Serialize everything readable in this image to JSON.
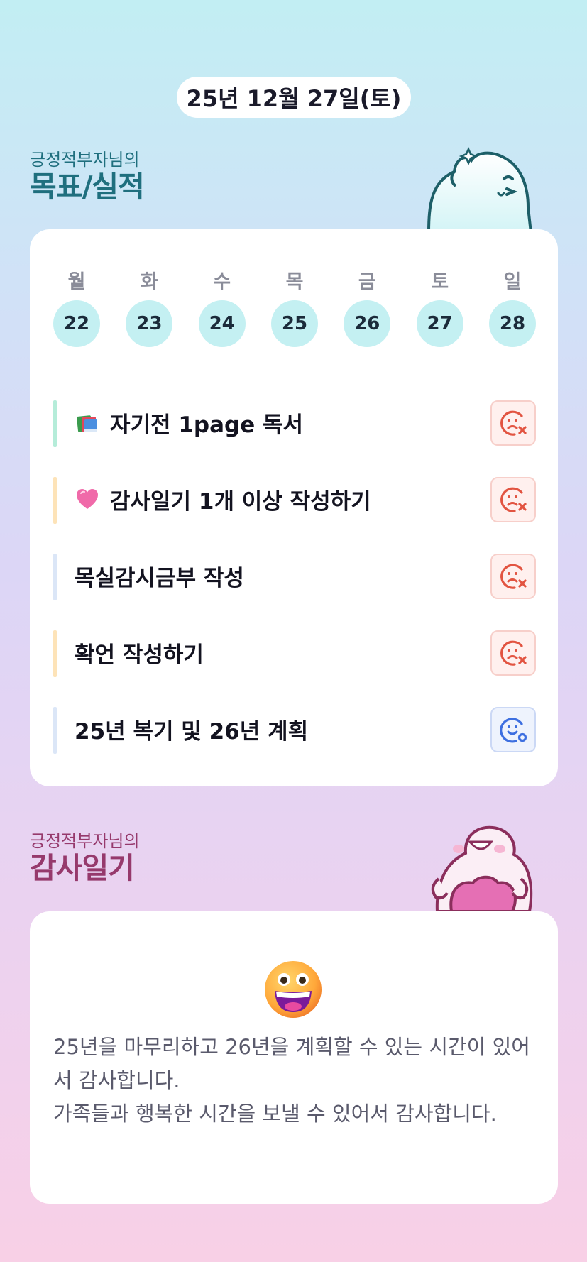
{
  "date": "25년 12월 27일(토)",
  "goals_section": {
    "subtitle": "긍정적부자님의",
    "title": "목표/실적"
  },
  "week": {
    "days": [
      {
        "name": "월",
        "num": "22"
      },
      {
        "name": "화",
        "num": "23"
      },
      {
        "name": "수",
        "num": "24"
      },
      {
        "name": "목",
        "num": "25"
      },
      {
        "name": "금",
        "num": "26"
      },
      {
        "name": "토",
        "num": "27"
      },
      {
        "name": "일",
        "num": "28"
      }
    ]
  },
  "goals": [
    {
      "label": "자기전 1page 독서",
      "emoji": "books-icon",
      "bar_color": "#b5ecd9",
      "status": "fail"
    },
    {
      "label": "감사일기 1개 이상 작성하기",
      "emoji": "heart-icon",
      "bar_color": "#fde3b8",
      "status": "fail"
    },
    {
      "label": "목실감시금부 작성",
      "emoji": "",
      "bar_color": "#dbe6f7",
      "status": "fail"
    },
    {
      "label": "확언 작성하기",
      "emoji": "",
      "bar_color": "#fde3b8",
      "status": "fail"
    },
    {
      "label": "25년 복기 및 26년 계획",
      "emoji": "",
      "bar_color": "#dbe6f7",
      "status": "success"
    }
  ],
  "thanks_section": {
    "subtitle": "긍정적부자님의",
    "title": "감사일기"
  },
  "thanks": {
    "emoji": "grinning-face-icon",
    "lines": [
      "25년을 마무리하고 26년을 계획할 수 있는 시간이 있어서 감사합니다.",
      "가족들과 행복한 시간을 보낼 수 있어서 감사합니다."
    ]
  },
  "colors": {
    "goals_title": "#1f6f7e",
    "thanks_title": "#96396c",
    "day_circle": "#c4f0f2",
    "fail": "#e25441",
    "success": "#3d6fe0"
  }
}
